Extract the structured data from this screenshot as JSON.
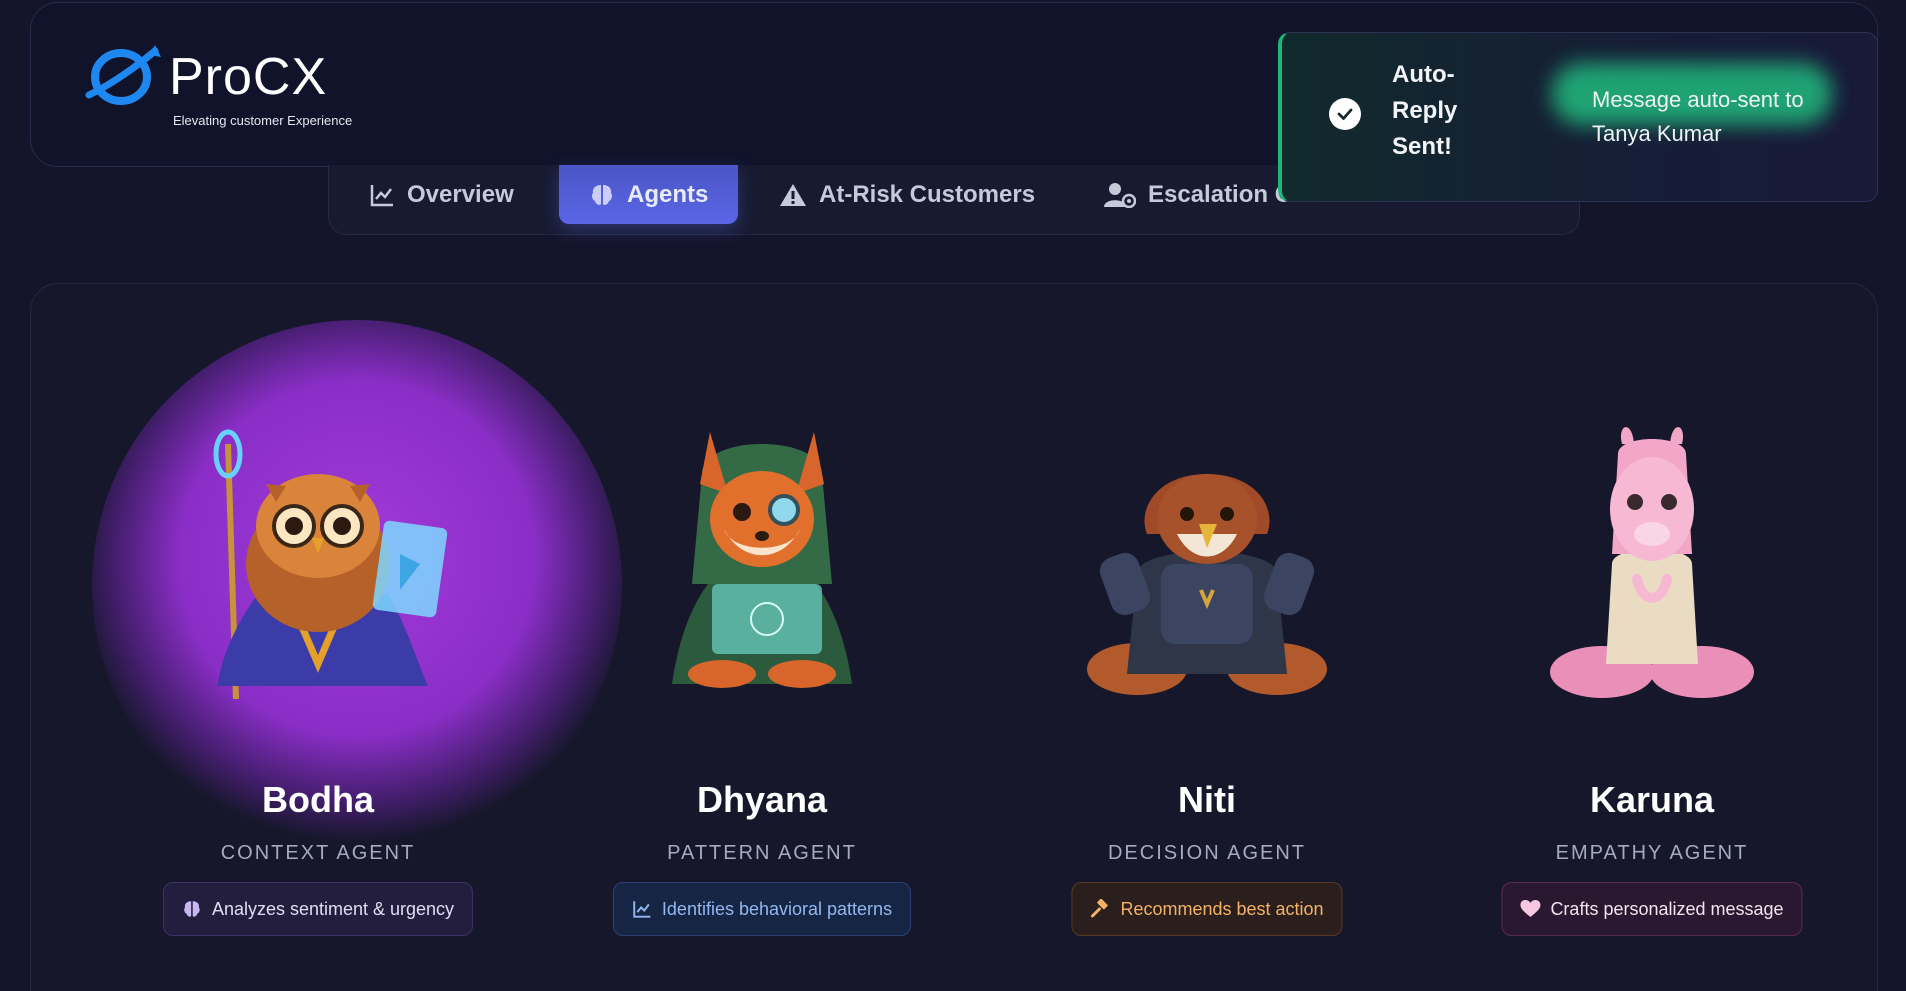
{
  "brand": {
    "title": "ProCX",
    "subtitle": "Elevating customer Experience",
    "accent": "#1e88f0"
  },
  "tabs": [
    {
      "label": "Overview",
      "icon": "chart-line-icon",
      "active": false
    },
    {
      "label": "Agents",
      "icon": "brain-icon",
      "active": true
    },
    {
      "label": "At-Risk Customers",
      "icon": "warning-icon",
      "active": false
    },
    {
      "label": "Escalation C",
      "icon": "user-gear-icon",
      "active": false
    }
  ],
  "toast": {
    "title": "Auto-Reply Sent!",
    "message": "Message auto-sent to Tanya Kumar",
    "icon": "check-circle-icon"
  },
  "agents": [
    {
      "name": "Bodha",
      "role": "CONTEXT AGENT",
      "tag": "Analyzes sentiment & urgency",
      "tag_icon": "brain-icon",
      "mascot": "owl-icon",
      "tag_color": "#e2dcf2",
      "highlighted": true
    },
    {
      "name": "Dhyana",
      "role": "PATTERN AGENT",
      "tag": "Identifies behavioral patterns",
      "tag_icon": "chart-line-icon",
      "mascot": "fox-icon",
      "tag_color": "#93b8ef"
    },
    {
      "name": "Niti",
      "role": "DECISION AGENT",
      "tag": "Recommends best action",
      "tag_icon": "gavel-icon",
      "mascot": "hawk-icon",
      "tag_color": "#f4b267"
    },
    {
      "name": "Karuna",
      "role": "EMPATHY AGENT",
      "tag": "Crafts personalized message",
      "tag_icon": "heart-icon",
      "mascot": "llama-icon",
      "tag_color": "#f1e4ee"
    }
  ]
}
